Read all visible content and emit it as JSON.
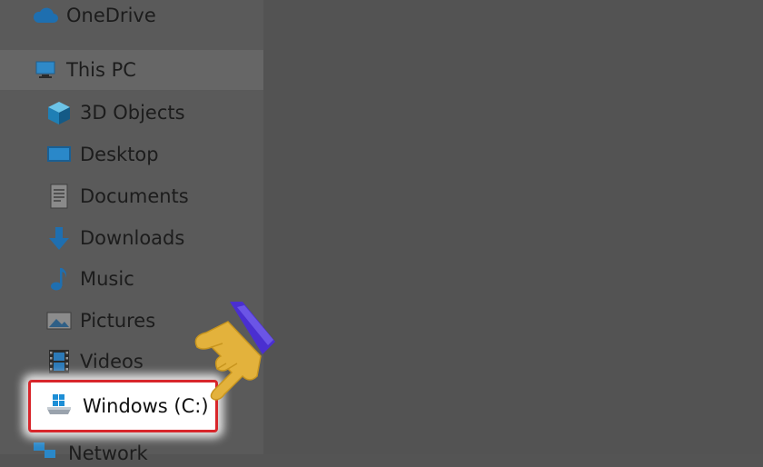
{
  "nav": {
    "onedrive": {
      "label": "OneDrive",
      "icon": "cloud-icon"
    },
    "this_pc": {
      "label": "This PC",
      "icon": "computer-icon"
    },
    "items": [
      {
        "label": "3D Objects",
        "icon": "cube-icon"
      },
      {
        "label": "Desktop",
        "icon": "monitor-icon"
      },
      {
        "label": "Documents",
        "icon": "document-icon"
      },
      {
        "label": "Downloads",
        "icon": "download-arrow-icon"
      },
      {
        "label": "Music",
        "icon": "music-note-icon"
      },
      {
        "label": "Pictures",
        "icon": "picture-icon"
      },
      {
        "label": "Videos",
        "icon": "film-icon"
      }
    ],
    "drive": {
      "label": "Windows (C:)",
      "icon": "windows-drive-icon"
    },
    "network": {
      "label": "Network",
      "icon": "network-icon"
    }
  },
  "colors": {
    "highlight_border": "#d8262b",
    "pointer_hand": "#e3b23c",
    "pointer_cuff": "#4a2fd0"
  }
}
